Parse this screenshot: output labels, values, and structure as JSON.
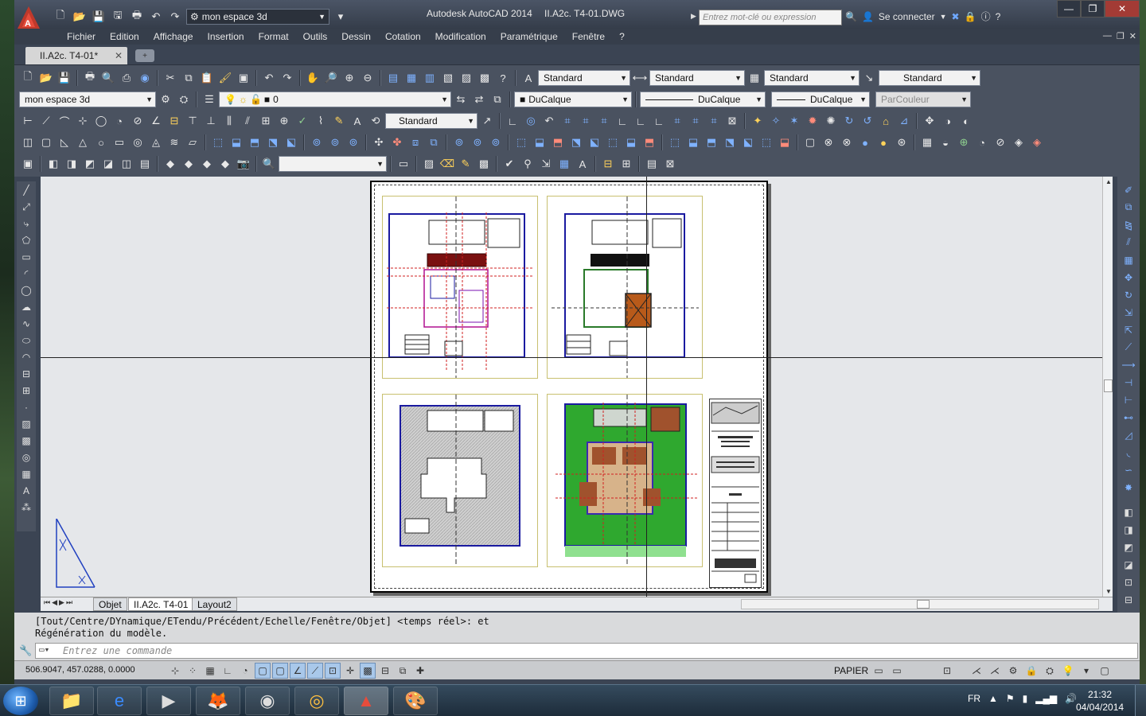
{
  "titlebar": {
    "app_name": "Autodesk AutoCAD 2014",
    "file_name": "II.A2c. T4-01.DWG",
    "workspace": "mon espace 3d",
    "search_placeholder": "Entrez mot-clé ou expression",
    "sign_in": "Se connecter",
    "help": "?"
  },
  "menu": [
    "Fichier",
    "Edition",
    "Affichage",
    "Insertion",
    "Format",
    "Outils",
    "Dessin",
    "Cotation",
    "Modification",
    "Paramétrique",
    "Fenêtre",
    "?"
  ],
  "doc_tab": {
    "label": "II.A2c. T4-01*"
  },
  "styles": {
    "text_style": "Standard",
    "dim_style": "Standard",
    "table_style": "Standard",
    "mleader_style": "Standard",
    "workspace_combo": "mon espace 3d",
    "layer": "0",
    "color": "DuCalque",
    "linetype": "DuCalque",
    "lineweight": "DuCalque",
    "plotstyle": "ParCouleur",
    "dim_style_2": "Standard"
  },
  "layout_tabs": [
    "Objet",
    "II.A2c. T4-01",
    "Layout2"
  ],
  "command": {
    "line1": "[Tout/Centre/DYnamique/ETendu/Précédent/Echelle/Fenêtre/Objet] <temps réel>: et",
    "line2": "Régénération du modèle.",
    "placeholder": "Entrez une commande"
  },
  "status": {
    "coords": "506.9047, 457.0288, 0.0000",
    "space": "PAPIER"
  },
  "taskbar": {
    "language": "FR",
    "time": "21:32",
    "date": "04/04/2014"
  },
  "colors": {
    "accent_red": "#c0392b",
    "plan_green": "#2fa82f",
    "plan_brown": "#a0522d"
  }
}
